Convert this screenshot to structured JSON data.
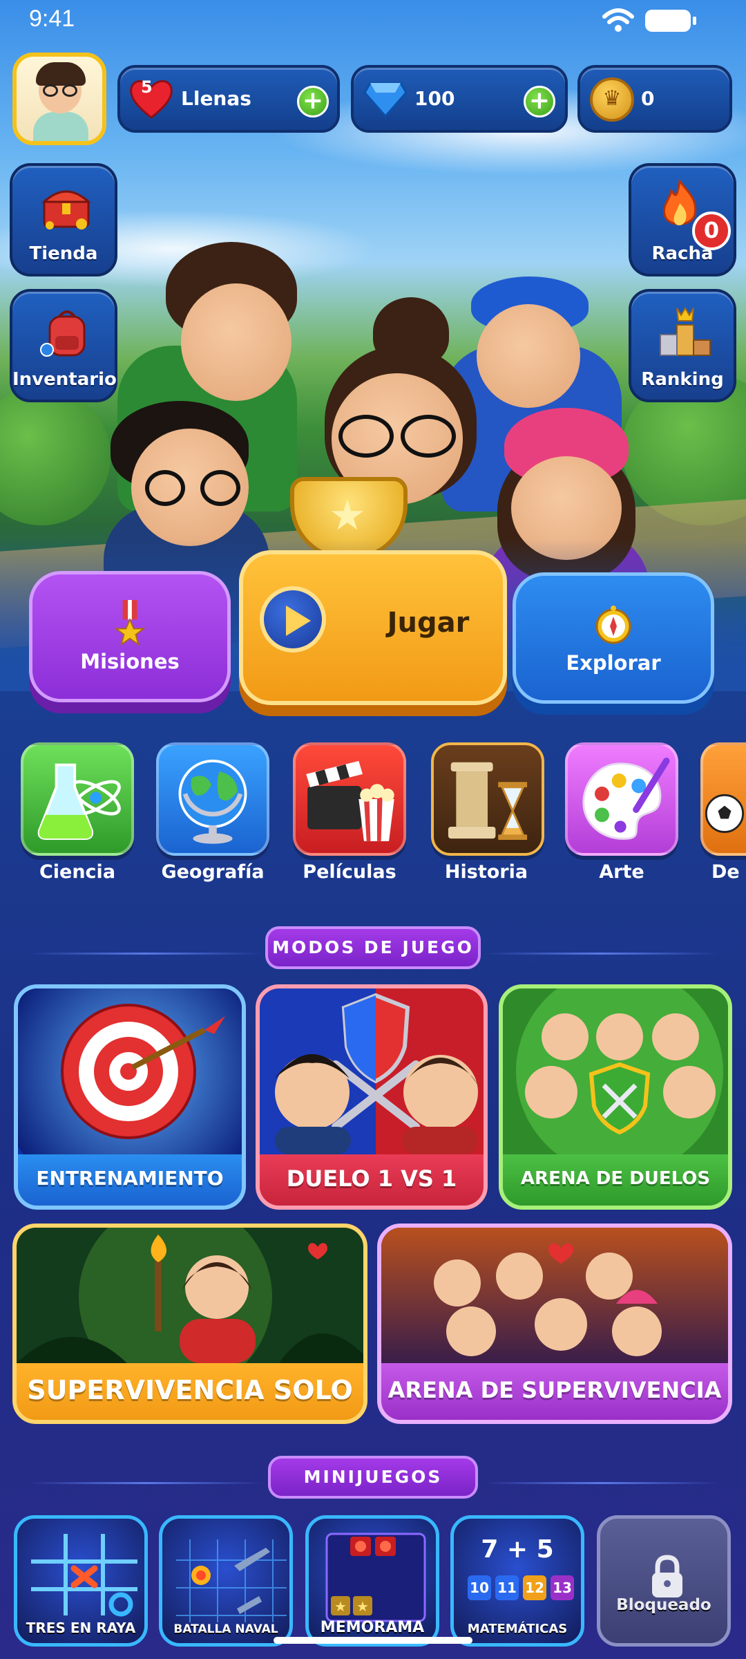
{
  "status_bar": {
    "time": "9:41"
  },
  "currency": {
    "lives_count": "5",
    "lives_label": "Llenas",
    "gems": "100",
    "coins": "0"
  },
  "side_left": [
    {
      "label": "Tienda",
      "icon": "treasure-chest-icon"
    },
    {
      "label": "Inventario",
      "icon": "backpack-icon"
    }
  ],
  "side_right": [
    {
      "label": "Racha",
      "icon": "flame-icon",
      "badge": "0"
    },
    {
      "label": "Ranking",
      "icon": "podium-icon"
    }
  ],
  "main_buttons": {
    "missions": "Misiones",
    "play": "Jugar",
    "explore": "Explorar"
  },
  "categories": [
    {
      "label": "Ciencia",
      "color": "#3fb93a"
    },
    {
      "label": "Geografía",
      "color": "#1f86e0"
    },
    {
      "label": "Películas",
      "color": "#d8262a"
    },
    {
      "label": "Historia",
      "color": "#c98a2b"
    },
    {
      "label": "Arte",
      "color": "#c54be0"
    },
    {
      "label": "De",
      "color": "#f08a1a"
    }
  ],
  "sections": {
    "modes_title": "MODOS DE JUEGO",
    "minigames_title": "MINIJUEGOS"
  },
  "modes": [
    {
      "label": "ENTRENAMIENTO",
      "color": "#1f78d8"
    },
    {
      "label": "DUELO 1 VS 1",
      "color": "#d8324a"
    },
    {
      "label": "ARENA DE DUELOS",
      "color": "#3cab34"
    },
    {
      "label": "SUPERVIVENCIA SOLO",
      "color": "#f29a16"
    },
    {
      "label": "ARENA DE SUPERVIVENCIA",
      "color": "#b142d6"
    }
  ],
  "minigames": [
    {
      "label": "TRES EN RAYA"
    },
    {
      "label": "BATALLA NAVAL"
    },
    {
      "label": "MEMORAMA"
    },
    {
      "label": "MATEMÁTICAS",
      "sum": "7 + 5",
      "options": [
        "10",
        "11",
        "12",
        "13"
      ]
    },
    {
      "label": "Bloqueado"
    }
  ]
}
